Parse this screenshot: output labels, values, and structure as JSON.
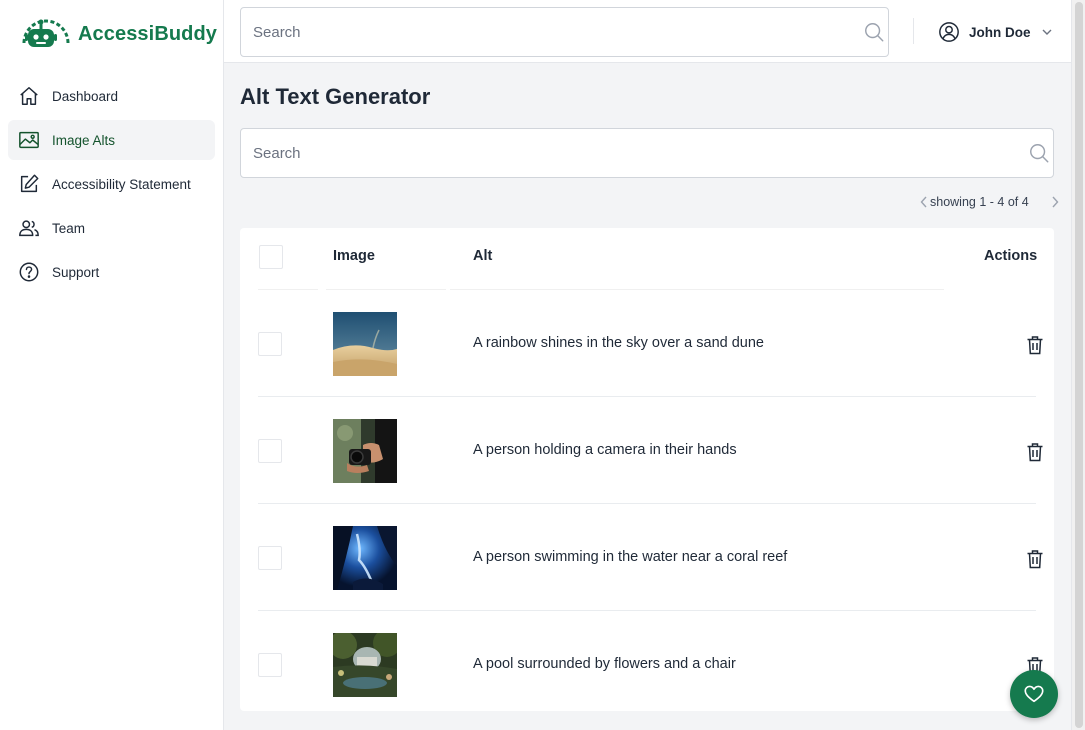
{
  "brand": {
    "name": "AccessiBuddy",
    "color": "#157a4e"
  },
  "sidebar": {
    "items": [
      {
        "label": "Dashboard",
        "icon": "home-icon",
        "active": false
      },
      {
        "label": "Image Alts",
        "icon": "image-icon",
        "active": true
      },
      {
        "label": "Accessibility Statement",
        "icon": "pencil-square-icon",
        "active": false
      },
      {
        "label": "Team",
        "icon": "users-icon",
        "active": false
      },
      {
        "label": "Support",
        "icon": "question-circle-icon",
        "active": false
      }
    ]
  },
  "topbar": {
    "search_placeholder": "Search",
    "user_name": "John Doe"
  },
  "main": {
    "title": "Alt Text Generator",
    "search_placeholder": "Search",
    "pager_text": "showing 1 - 4 of 4",
    "table": {
      "headers": {
        "image": "Image",
        "alt": "Alt",
        "actions": "Actions"
      },
      "rows": [
        {
          "alt": "A rainbow shines in the sky over a sand dune",
          "thumb": "sand-dune-photo"
        },
        {
          "alt": "A person holding a camera in their hands",
          "thumb": "camera-photo"
        },
        {
          "alt": "A person swimming in the water near a coral reef",
          "thumb": "underwater-photo"
        },
        {
          "alt": "A pool surrounded by flowers and a chair",
          "thumb": "garden-pool-photo"
        }
      ]
    }
  },
  "fab": {
    "icon": "heart-icon"
  }
}
